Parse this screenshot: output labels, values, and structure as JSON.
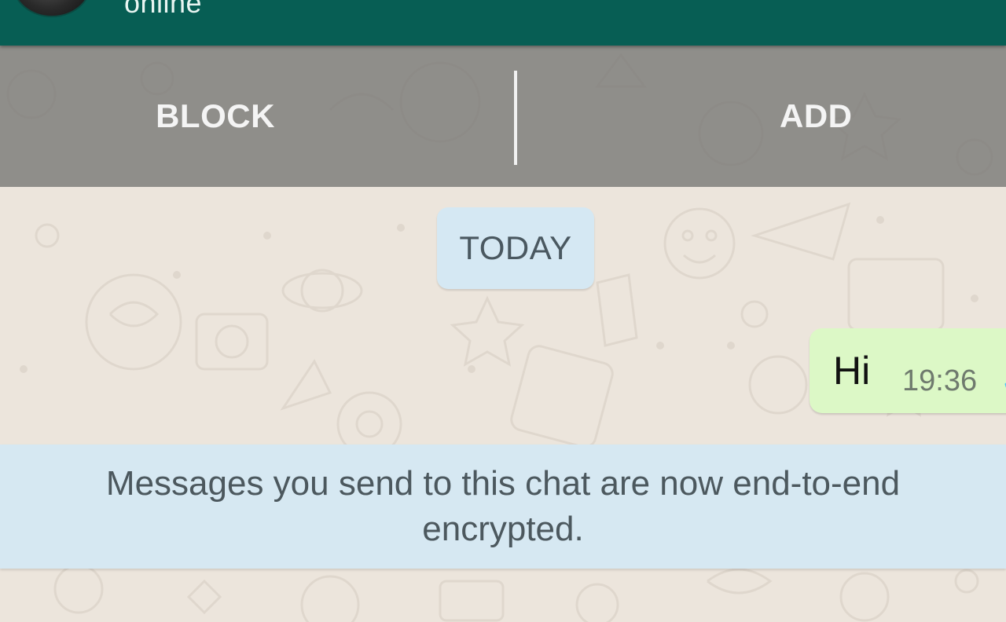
{
  "header": {
    "status": "online",
    "bar_color": "#075e54"
  },
  "actions": {
    "block_label": "BLOCK",
    "add_label": "ADD"
  },
  "chat": {
    "date_chip": "TODAY",
    "messages": [
      {
        "direction": "outgoing",
        "text": "Hi",
        "time": "19:36",
        "status_icon": "check-icon"
      }
    ],
    "notice": "Messages you send to this chat are now end-to-end encrypted."
  },
  "colors": {
    "outgoing_bubble": "#dcf8c6",
    "system_chip": "#d5e8f3",
    "wallpaper": "#ece5dc",
    "tick": "#4fc3f7"
  }
}
